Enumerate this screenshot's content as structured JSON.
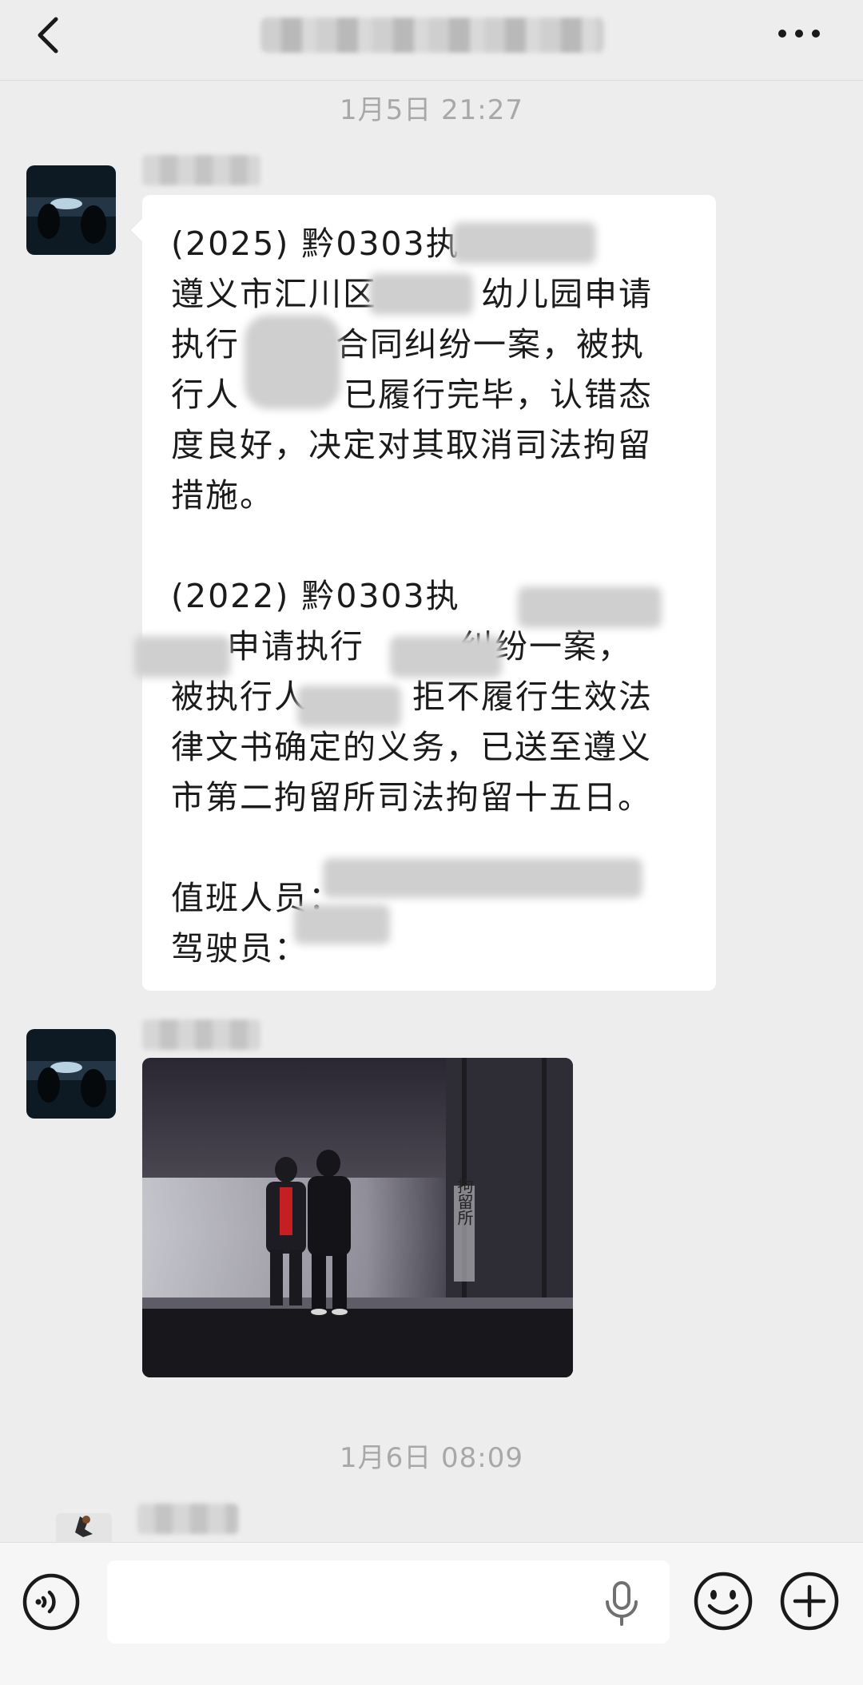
{
  "header": {
    "back_icon": "chevron-left-icon",
    "more_icon": "more-icon"
  },
  "timestamps": [
    "1月5日 21:27",
    "1月6日 08:09"
  ],
  "message": {
    "p1": "(2025) 黔0303执",
    "p2": "遵义市汇川区",
    "p3": "幼儿园申请",
    "p4": "执行",
    "p5": "合同纠纷一案，被执",
    "p6": "行人",
    "p7": "已履行完毕，认错态",
    "p8": "度良好，决定对其取消司法拘留",
    "p9": "措施。",
    "q1": "(2022) 黔0303执",
    "q2": "申请执行",
    "q3": "纠纷一案，",
    "q4": "被执行人",
    "q5": "拒不履行生效法",
    "q6": "律文书确定的义务，已送至遵义",
    "q7": "市第二拘留所司法拘留十五日。",
    "duty_label": "值班人员：",
    "driver_label": "驾驶员："
  },
  "photo_sign": "拘留所",
  "composer": {
    "voice_icon": "voice-icon",
    "mic_icon": "microphone-icon",
    "emoji_icon": "emoji-icon",
    "add_icon": "plus-circle-icon"
  },
  "colors": {
    "background": "#ededed",
    "bubble": "#ffffff",
    "timestamp": "#a8a8a8"
  }
}
